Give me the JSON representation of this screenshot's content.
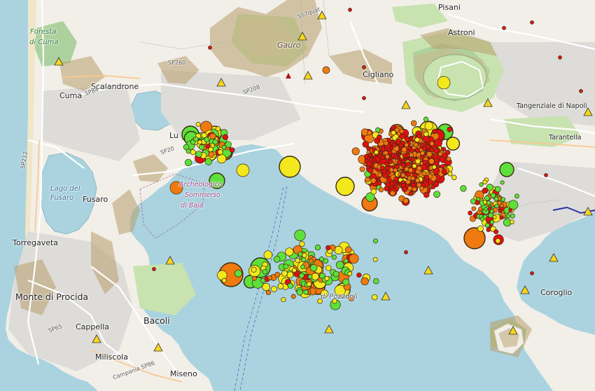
{
  "map": {
    "place_labels": [
      {
        "id": "pisani",
        "text": "Pisani",
        "style": "",
        "pos": "pisani"
      },
      {
        "id": "astroni",
        "text": "Astroni",
        "style": "",
        "pos": "astroni"
      },
      {
        "id": "foresta",
        "text": "Foresta",
        "style": "green",
        "pos": "foresta"
      },
      {
        "id": "dicuma",
        "text": "di Cuma",
        "style": "green",
        "pos": "dicuma"
      },
      {
        "id": "cuma",
        "text": "Cuma",
        "style": "",
        "pos": "cuma"
      },
      {
        "id": "scalandrone",
        "text": "Scalandrone",
        "style": "",
        "pos": "scalandrone"
      },
      {
        "id": "gauro",
        "text": "Gauro",
        "style": "italic",
        "pos": "gauro"
      },
      {
        "id": "cigliano",
        "text": "Cigliano",
        "style": "",
        "pos": "cigliano"
      },
      {
        "id": "tangenziale",
        "text": "Tangenziale di Napoli",
        "style": "small",
        "pos": "tangenziale"
      },
      {
        "id": "tarantella",
        "text": "Tarantella",
        "style": "small",
        "pos": "tarantella"
      },
      {
        "id": "lu",
        "text": "Lu",
        "style": "",
        "pos": "lu"
      },
      {
        "id": "lagodel",
        "text": "Lago del",
        "style": "blue",
        "pos": "lagodel"
      },
      {
        "id": "fusaro_lake",
        "text": "Fusaro",
        "style": "blue",
        "pos": "fusarolake"
      },
      {
        "id": "fusaro",
        "text": "Fusaro",
        "style": "",
        "pos": "fusaro"
      },
      {
        "id": "archeo1",
        "text": "Archeologico",
        "style": "purple",
        "pos": "archeo1"
      },
      {
        "id": "archeo2",
        "text": "Sommerso",
        "style": "purple",
        "pos": "archeo2"
      },
      {
        "id": "archeo3",
        "text": "di Baia",
        "style": "purple",
        "pos": "archeo3"
      },
      {
        "id": "torregaveta",
        "text": "Torregaveta",
        "style": "",
        "pos": "torregaveta"
      },
      {
        "id": "montediprocida",
        "text": "Monte di Procida",
        "style": "big",
        "pos": "montedi"
      },
      {
        "id": "bacoli",
        "text": "Bacoli",
        "style": "big",
        "pos": "bacoli"
      },
      {
        "id": "cappella",
        "text": "Cappella",
        "style": "",
        "pos": "cappella"
      },
      {
        "id": "miliscola",
        "text": "Miliscola",
        "style": "",
        "pos": "miliscola"
      },
      {
        "id": "miseno",
        "text": "Miseno",
        "style": "",
        "pos": "miseno"
      },
      {
        "id": "coroglio",
        "text": "Coroglio",
        "style": "",
        "pos": "coroglio"
      },
      {
        "id": "golfo",
        "text": "di Pozzuoli",
        "style": "ital",
        "pos": "golfo"
      },
      {
        "id": "sp84",
        "text": "SP84",
        "style": "tiny",
        "pos": "sp84"
      },
      {
        "id": "sp208",
        "text": "SP208",
        "style": "tiny",
        "pos": "sp208"
      },
      {
        "id": "sp20",
        "text": "SP20",
        "style": "tiny",
        "pos": "sp20"
      },
      {
        "id": "sp212",
        "text": "SP212",
        "style": "tiny",
        "pos": "sp212"
      },
      {
        "id": "sp65",
        "text": "SP65",
        "style": "tiny",
        "pos": "sp65"
      },
      {
        "id": "ss7q",
        "text": "SS7quat",
        "style": "tiny",
        "pos": "ss7q"
      },
      {
        "id": "sp260",
        "text": "SP260",
        "style": "tiny",
        "pos": "sp260"
      },
      {
        "id": "campania",
        "text": "Campania SP86",
        "style": "tiny",
        "pos": "campania"
      }
    ],
    "colors": {
      "sea": "#aad3df",
      "land": "#f2efe9",
      "urban": "#e0dfdf",
      "park": "#c8e2b0",
      "forest": "#add19e",
      "relief": "#b89f6c",
      "quake_red": "#e01010",
      "quake_orange": "#f07a10",
      "quake_yellow": "#f3e81d",
      "quake_green": "#5ee03a",
      "station": "#f8d61b"
    }
  }
}
